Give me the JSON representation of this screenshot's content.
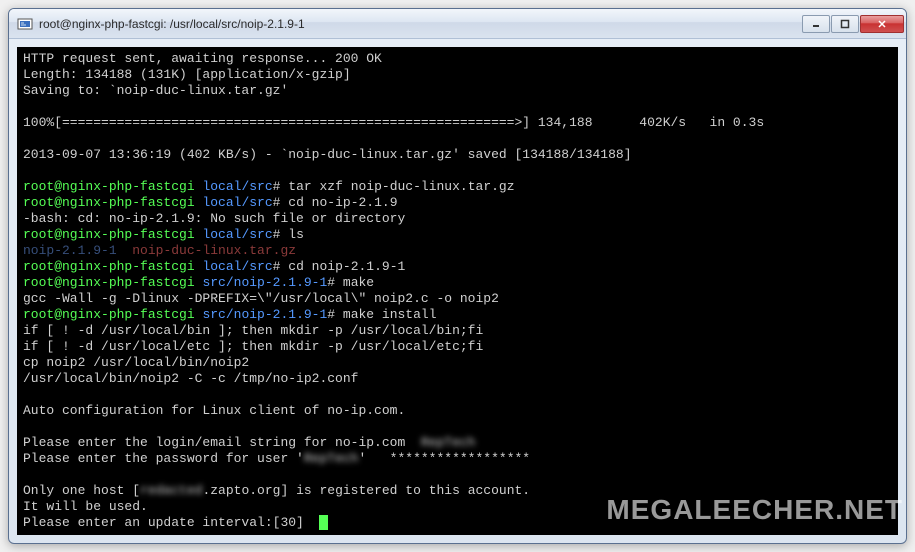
{
  "window": {
    "title": "root@nginx-php-fastcgi: /usr/local/src/noip-2.1.9-1"
  },
  "term": {
    "http_line": "HTTP request sent, awaiting response... 200 OK",
    "length_line": "Length: 134188 (131K) [application/x-gzip]",
    "saving_line": "Saving to: `noip-duc-linux.tar.gz'",
    "progress_line": "100%[==========================================================>] 134,188      402K/s   in 0.3s",
    "saved_line": "2013-09-07 13:36:19 (402 KB/s) - `noip-duc-linux.tar.gz' saved [134188/134188]",
    "prompt_user": "root@nginx-php-fastcgi",
    "path_local_src": "local/src",
    "path_noip": "src/noip-2.1.9-1",
    "cmd1": "tar xzf noip-duc-linux.tar.gz",
    "cmd2": "cd no-ip-2.1.9",
    "bash_err": "-bash: cd: no-ip-2.1.9: No such file or directory",
    "cmd3": "ls",
    "ls_dir": "noip-2.1.9-1",
    "ls_file": "noip-duc-linux.tar.gz",
    "cmd4": "cd noip-2.1.9-1",
    "cmd5": "make",
    "gcc_line": "gcc -Wall -g -Dlinux -DPREFIX=\\\"/usr/local\\\" noip2.c -o noip2",
    "cmd6": "make install",
    "if_bin": "if [ ! -d /usr/local/bin ]; then mkdir -p /usr/local/bin;fi",
    "if_etc": "if [ ! -d /usr/local/etc ]; then mkdir -p /usr/local/etc;fi",
    "cp_line": "cp noip2 /usr/local/bin/noip2",
    "conf_line": "/usr/local/bin/noip2 -C -c /tmp/no-ip2.conf",
    "auto_conf": "Auto configuration for Linux client of no-ip.com.",
    "login_prompt": "Please enter the login/email string for no-ip.com  ",
    "login_value": "RepTech",
    "pass_prompt_a": "Please enter the password for user '",
    "pass_prompt_user": "RepTech",
    "pass_prompt_b": "'   ******************",
    "host_a": "Only one host [",
    "host_blur": "redacted",
    "host_b": ".zapto.org] is registered to this account.",
    "used": "It will be used.",
    "interval": "Please enter an update interval:[30]  "
  },
  "watermark": "MEGALEECHER.NET"
}
